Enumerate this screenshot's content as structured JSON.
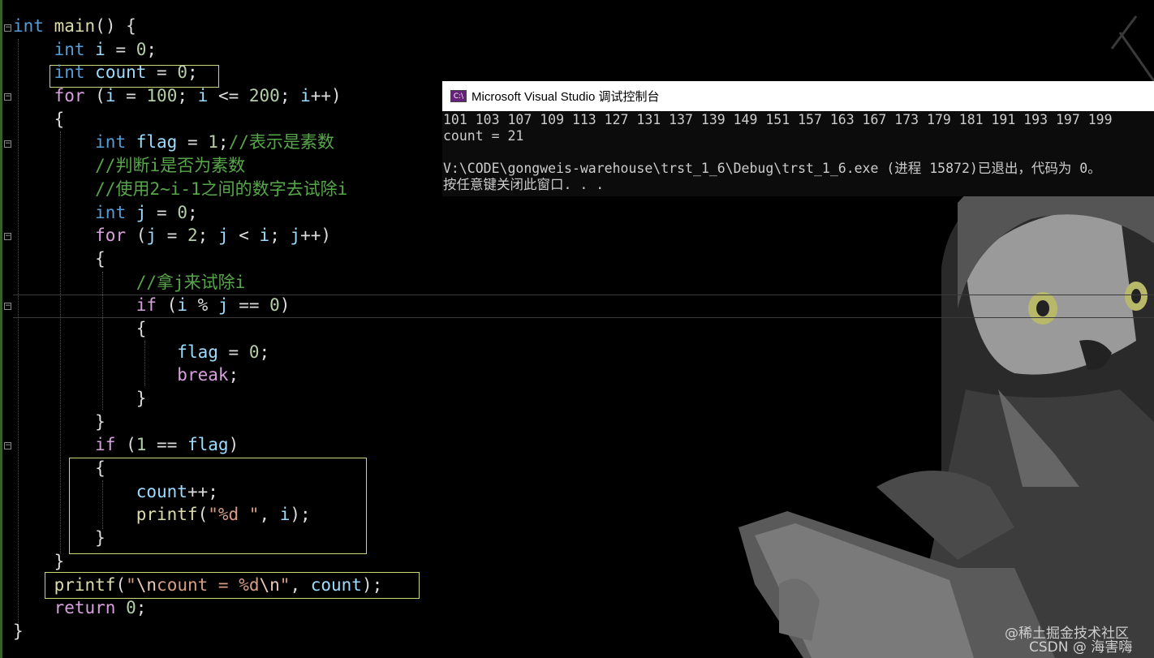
{
  "editor": {
    "lines": [
      [
        [
          "kw",
          "int"
        ],
        [
          "pl",
          " "
        ],
        [
          "fn",
          "main"
        ],
        [
          "pl",
          "() {"
        ]
      ],
      [
        [
          "pl",
          "    "
        ],
        [
          "kw",
          "int"
        ],
        [
          "pl",
          " "
        ],
        [
          "var",
          "i"
        ],
        [
          "pl",
          " = "
        ],
        [
          "num",
          "0"
        ],
        [
          "pl",
          ";"
        ]
      ],
      [
        [
          "pl",
          "    "
        ],
        [
          "kw",
          "int"
        ],
        [
          "pl",
          " "
        ],
        [
          "var",
          "count"
        ],
        [
          "pl",
          " = "
        ],
        [
          "num",
          "0"
        ],
        [
          "pl",
          ";"
        ]
      ],
      [
        [
          "pl",
          "    "
        ],
        [
          "kw2",
          "for"
        ],
        [
          "pl",
          " ("
        ],
        [
          "var",
          "i"
        ],
        [
          "pl",
          " = "
        ],
        [
          "num",
          "100"
        ],
        [
          "pl",
          "; "
        ],
        [
          "var",
          "i"
        ],
        [
          "pl",
          " <= "
        ],
        [
          "num",
          "200"
        ],
        [
          "pl",
          "; "
        ],
        [
          "var",
          "i"
        ],
        [
          "pl",
          "++)"
        ]
      ],
      [
        [
          "pl",
          "    {"
        ]
      ],
      [
        [
          "pl",
          "        "
        ],
        [
          "kw",
          "int"
        ],
        [
          "pl",
          " "
        ],
        [
          "var",
          "flag"
        ],
        [
          "pl",
          " = "
        ],
        [
          "num",
          "1"
        ],
        [
          "pl",
          ";"
        ],
        [
          "cm",
          "//表示是素数"
        ]
      ],
      [
        [
          "pl",
          "        "
        ],
        [
          "cm",
          "//判断i是否为素数"
        ]
      ],
      [
        [
          "pl",
          "        "
        ],
        [
          "cm",
          "//使用2~i-1之间的数字去试除i"
        ]
      ],
      [
        [
          "pl",
          "        "
        ],
        [
          "kw",
          "int"
        ],
        [
          "pl",
          " "
        ],
        [
          "var",
          "j"
        ],
        [
          "pl",
          " = "
        ],
        [
          "num",
          "0"
        ],
        [
          "pl",
          ";"
        ]
      ],
      [
        [
          "pl",
          "        "
        ],
        [
          "kw2",
          "for"
        ],
        [
          "pl",
          " ("
        ],
        [
          "var",
          "j"
        ],
        [
          "pl",
          " = "
        ],
        [
          "num",
          "2"
        ],
        [
          "pl",
          "; "
        ],
        [
          "var",
          "j"
        ],
        [
          "pl",
          " < "
        ],
        [
          "var",
          "i"
        ],
        [
          "pl",
          "; "
        ],
        [
          "var",
          "j"
        ],
        [
          "pl",
          "++)"
        ]
      ],
      [
        [
          "pl",
          "        {"
        ]
      ],
      [
        [
          "pl",
          "            "
        ],
        [
          "cm",
          "//拿j来试除i"
        ]
      ],
      [
        [
          "pl",
          "            "
        ],
        [
          "kw2",
          "if"
        ],
        [
          "pl",
          " ("
        ],
        [
          "var",
          "i"
        ],
        [
          "pl",
          " % "
        ],
        [
          "var",
          "j"
        ],
        [
          "pl",
          " == "
        ],
        [
          "num",
          "0"
        ],
        [
          "pl",
          ")"
        ]
      ],
      [
        [
          "pl",
          "            {"
        ]
      ],
      [
        [
          "pl",
          "                "
        ],
        [
          "var",
          "flag"
        ],
        [
          "pl",
          " = "
        ],
        [
          "num",
          "0"
        ],
        [
          "pl",
          ";"
        ]
      ],
      [
        [
          "pl",
          "                "
        ],
        [
          "kw2",
          "break"
        ],
        [
          "pl",
          ";"
        ]
      ],
      [
        [
          "pl",
          "            }"
        ]
      ],
      [
        [
          "pl",
          "        }"
        ]
      ],
      [
        [
          "pl",
          "        "
        ],
        [
          "kw2",
          "if"
        ],
        [
          "pl",
          " ("
        ],
        [
          "num",
          "1"
        ],
        [
          "pl",
          " == "
        ],
        [
          "var",
          "flag"
        ],
        [
          "pl",
          ")"
        ]
      ],
      [
        [
          "pl",
          "        {"
        ]
      ],
      [
        [
          "pl",
          "            "
        ],
        [
          "var",
          "count"
        ],
        [
          "pl",
          "++;"
        ]
      ],
      [
        [
          "pl",
          "            "
        ],
        [
          "fn",
          "printf"
        ],
        [
          "pl",
          "("
        ],
        [
          "str",
          "\"%d \""
        ],
        [
          "pl",
          ", "
        ],
        [
          "var",
          "i"
        ],
        [
          "pl",
          ");"
        ]
      ],
      [
        [
          "pl",
          "        }"
        ]
      ],
      [
        [
          "pl",
          "    }"
        ]
      ],
      [
        [
          "pl",
          "    "
        ],
        [
          "fn",
          "printf"
        ],
        [
          "pl",
          "("
        ],
        [
          "str",
          "\""
        ],
        [
          "esc",
          "\\n"
        ],
        [
          "str",
          "count = %d"
        ],
        [
          "esc",
          "\\n"
        ],
        [
          "str",
          "\""
        ],
        [
          "pl",
          ", "
        ],
        [
          "var",
          "count"
        ],
        [
          "pl",
          ");"
        ]
      ],
      [
        [
          "pl",
          "    "
        ],
        [
          "kw2",
          "return"
        ],
        [
          "pl",
          " "
        ],
        [
          "num",
          "0"
        ],
        [
          "pl",
          ";"
        ]
      ],
      [
        [
          "pl",
          "}"
        ]
      ]
    ]
  },
  "console": {
    "title": "Microsoft Visual Studio 调试控制台",
    "icon": "visual-studio-icon",
    "output_lines": [
      "101 103 107 109 113 127 131 137 139 149 151 157 163 167 173 179 181 191 193 197 199",
      "count = 21",
      "",
      "V:\\CODE\\gongweis-warehouse\\trst_1_6\\Debug\\trst_1_6.exe (进程 15872)已退出，代码为 0。",
      "按任意键关闭此窗口. . ."
    ]
  },
  "watermark": {
    "site": "@稀土掘金技术社区",
    "credit": "CSDN @  海害嗨"
  }
}
